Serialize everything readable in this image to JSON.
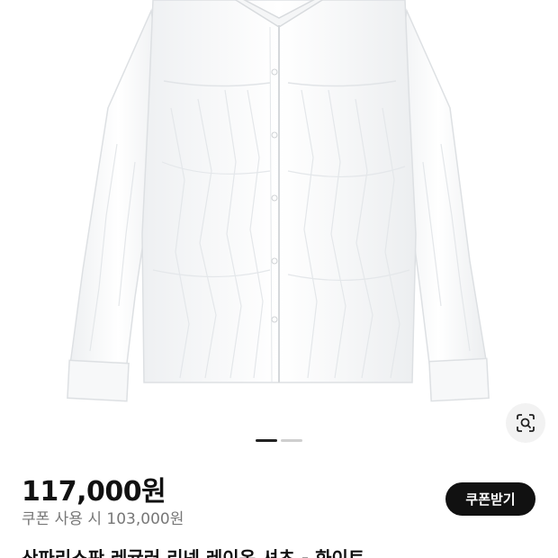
{
  "product": {
    "image_alt": "white crinkled linen shirt",
    "price": "117,000원",
    "coupon_price": "쿠폰 사용 시 103,000원",
    "coupon_button_label": "쿠폰받기",
    "title": "산파리스판 레귤러 리넨 레이온 셔츠 - 화이트"
  },
  "carousel": {
    "total_pages": 2,
    "active_page": 1
  },
  "icons": {
    "lens": "lens-search-icon"
  },
  "colors": {
    "button_bg": "#111111",
    "pager_active": "#222222",
    "pager_inactive": "#cfcfcf",
    "secondary_text": "#777777"
  }
}
